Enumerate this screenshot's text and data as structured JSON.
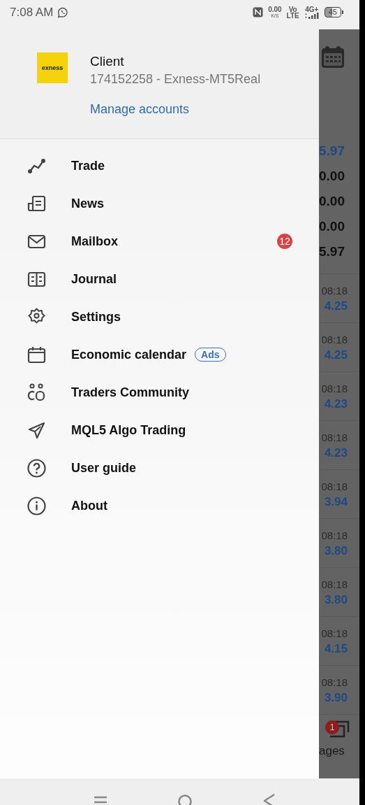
{
  "status_bar": {
    "time": "7:08 AM",
    "net_speed": "0.00",
    "net_unit": "K/S",
    "volte_top": "Vo",
    "volte_bottom": "LTE",
    "network": "4G+",
    "battery": "45"
  },
  "account": {
    "logo_text": "exness",
    "name": "Client",
    "details": "174152258 - Exness-MT5Real",
    "manage_link": "Manage accounts"
  },
  "menu": [
    {
      "kind": "trade",
      "label": "Trade"
    },
    {
      "kind": "news",
      "label": "News"
    },
    {
      "kind": "mail",
      "label": "Mailbox",
      "badge": "12"
    },
    {
      "kind": "journal",
      "label": "Journal"
    },
    {
      "kind": "settings",
      "label": "Settings"
    },
    {
      "kind": "calendar",
      "label": "Economic calendar",
      "tag": "Ads"
    },
    {
      "kind": "community",
      "label": "Traders Community"
    },
    {
      "kind": "send",
      "label": "MQL5 Algo Trading"
    },
    {
      "kind": "help",
      "label": "User guide"
    },
    {
      "kind": "info",
      "label": "About"
    }
  ],
  "background": {
    "top_values": [
      {
        "text": "5.97",
        "color": "#1d4a86"
      },
      {
        "text": "0.00",
        "color": "#111111"
      },
      {
        "text": "0.00",
        "color": "#111111"
      },
      {
        "text": "0.00",
        "color": "#111111"
      },
      {
        "text": "5.97",
        "color": "#111111"
      }
    ],
    "quotes": [
      {
        "time": "08:18",
        "price": "4.25"
      },
      {
        "time": "08:18",
        "price": "4.25"
      },
      {
        "time": "08:18",
        "price": "4.23"
      },
      {
        "time": "08:18",
        "price": "4.23"
      },
      {
        "time": "08:18",
        "price": "3.94"
      },
      {
        "time": "08:18",
        "price": "3.80"
      },
      {
        "time": "08:18",
        "price": "3.80"
      },
      {
        "time": "08:18",
        "price": "4.15"
      },
      {
        "time": "08:18",
        "price": "3.90"
      }
    ],
    "tab_label": "ages",
    "tab_badge": "1"
  }
}
